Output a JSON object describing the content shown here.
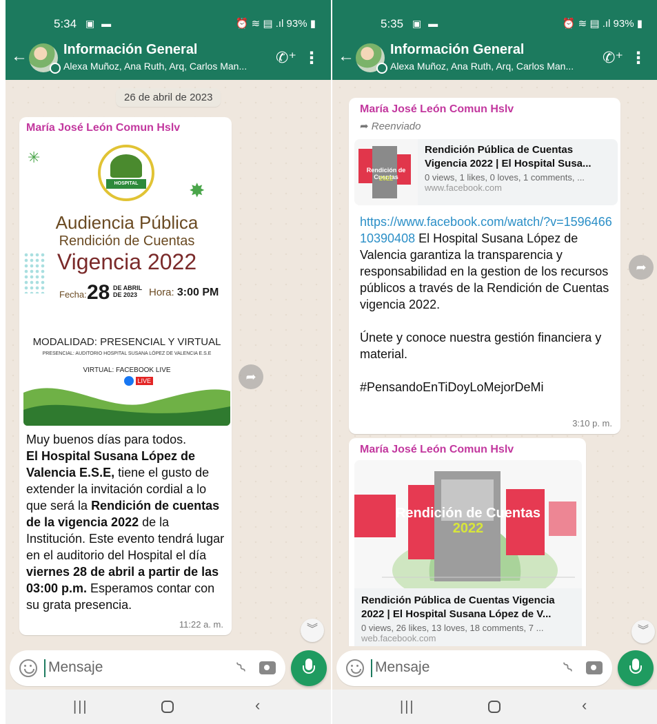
{
  "left": {
    "status": {
      "time": "5:34",
      "battery": "93%",
      "left_icons": "▣ ▬",
      "right_icons": "⏰ ≋ ▤ .ıl 93% ▮"
    },
    "header": {
      "title": "Información General",
      "participants": "Alexa Muñoz, Ana Ruth, Arq, Carlos Man..."
    },
    "date_pill": "26 de abril de 2023",
    "message": {
      "sender": "María José León Comun Hslv",
      "poster": {
        "logo_text": "HOSPITAL",
        "title1": "Audiencia Pública",
        "title2": "Rendición de Cuentas",
        "title3": "Vigencia 2022",
        "fecha_label": "Fecha:",
        "day": "28",
        "month_line1": "DE ABRIL",
        "month_line2": "DE 2023",
        "hora_label": "Hora:",
        "hora_value": "3:00 PM",
        "modalidad": "MODALIDAD: PRESENCIAL Y VIRTUAL",
        "presencial": "PRESENCIAL: AUDITORIO HOSPITAL SUSANA LÓPEZ DE VALENCIA E.S.E",
        "virtual": "VIRTUAL: FACEBOOK LIVE",
        "live": "LIVE"
      },
      "text_l1": "Muy buenos días para todos.",
      "text_b1": "El Hospital Susana López de Valencia E.S.E,",
      "text_l2": " tiene el gusto de extender la invitación cordial a lo que será la ",
      "text_b2": "Rendición  de cuentas de la vigencia 2022",
      "text_l3": " de la Institución. Este evento tendrá lugar en el auditorio del Hospital el día ",
      "text_b3": "viernes 28 de abril a partir de las 03:00 p.m.",
      "text_l4": " Esperamos contar con su grata presencia.",
      "time": "11:22 a. m."
    },
    "input_placeholder": "Mensaje"
  },
  "right": {
    "status": {
      "time": "5:35",
      "battery": "93%",
      "left_icons": "▣ ▬",
      "right_icons": "⏰ ≋ ▤ .ıl 93% ▮"
    },
    "header": {
      "title": "Información General",
      "participants": "Alexa Muñoz, Ana Ruth, Arq, Carlos Man..."
    },
    "message1": {
      "sender": "María José León Comun Hslv",
      "forwarded": "Reenviado",
      "preview": {
        "thumb_text": "Rendición de Cuentas",
        "thumb_year": "2022",
        "title": "Rendición Pública de Cuentas Vigencia 2022 | El Hospital Susa...",
        "desc": "0 views, 1 likes, 0 loves, 1 comments, ...",
        "site": "www.facebook.com"
      },
      "link": "https://www.facebook.com/watch/?v=159646610390408",
      "text1": " El Hospital Susana López de Valencia garantiza la transparencia y responsabilidad en la gestion de los recursos públicos a través de la Rendición de Cuentas vigencia 2022.",
      "text2": "Únete y conoce nuestra gestión financiera y material.",
      "hashtag": "#PensandoEnTiDoyLoMejorDeMi",
      "time": "3:10 p. m."
    },
    "message2": {
      "sender": "María José León Comun Hslv",
      "preview": {
        "image_title": "Rendición de Cuentas",
        "image_year": "2022",
        "title": "Rendición Pública de Cuentas Vigencia 2022 | El Hospital Susana López de V...",
        "desc": "0 views, 26 likes, 13 loves, 18 comments, 7 ...",
        "site": "web.facebook.com"
      }
    },
    "input_placeholder": "Mensaje"
  },
  "colors": {
    "header": "#1c7a5e",
    "sender": "#c2379e",
    "link": "#2b8fc7",
    "mic": "#1f9b60",
    "chat_bg": "#efe7de"
  },
  "icons": [
    "back-arrow-icon",
    "add-call-icon",
    "more-vert-icon",
    "forward-icon",
    "scroll-down-icon",
    "emoji-icon",
    "attach-icon",
    "camera-icon",
    "mic-icon",
    "nav-recent-icon",
    "nav-home-icon",
    "nav-back-icon"
  ]
}
